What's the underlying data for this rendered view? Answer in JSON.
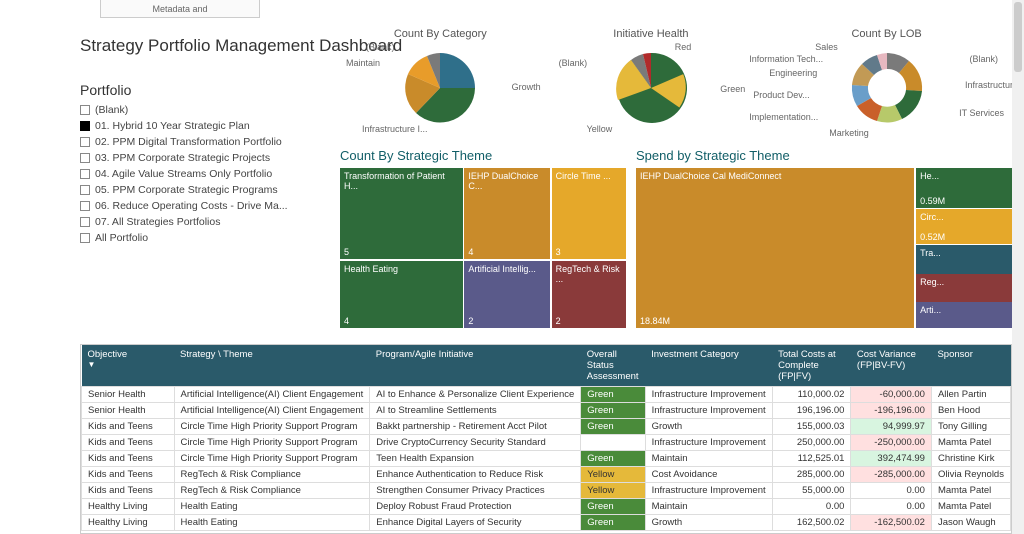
{
  "tabs": {
    "top": "Metadata and"
  },
  "title": "Strategy Portfolio Management Dashboard",
  "portfolio": {
    "heading": "Portfolio",
    "items": [
      {
        "label": "(Blank)",
        "checked": false
      },
      {
        "label": "01. Hybrid 10 Year Strategic Plan",
        "checked": true
      },
      {
        "label": "02. PPM Digital Transformation Portfolio",
        "checked": false
      },
      {
        "label": "03. PPM Corporate Strategic Projects",
        "checked": false
      },
      {
        "label": "04. Agile Value Streams Only Portfolio",
        "checked": false
      },
      {
        "label": "05. PPM Corporate Strategic Programs",
        "checked": false
      },
      {
        "label": "06. Reduce Operating Costs - Drive Ma...",
        "checked": false
      },
      {
        "label": "07. All Strategies Portfolios",
        "checked": false
      },
      {
        "label": "All Portfolio",
        "checked": false
      }
    ]
  },
  "charts": {
    "category": {
      "title": "Count By Category",
      "labels": {
        "blank": "(Blank)",
        "maintain": "Maintain",
        "growth": "Growth",
        "infra": "Infrastructure I..."
      }
    },
    "health": {
      "title": "Initiative Health",
      "labels": {
        "red": "Red",
        "blank": "(Blank)",
        "green": "Green",
        "yellow": "Yellow"
      }
    },
    "lob": {
      "title": "Count By LOB",
      "labels": {
        "sales": "Sales",
        "infotech": "Information Tech...",
        "engineering": "Engineering",
        "proddev": "Product Dev...",
        "impl": "Implementation...",
        "marketing": "Marketing",
        "blank": "(Blank)",
        "infra": "Infrastructure",
        "its": "IT Services"
      }
    }
  },
  "chart_data": [
    {
      "type": "pie",
      "title": "Count By Category",
      "series": [
        {
          "name": "Count",
          "values": [
            2,
            2,
            10,
            8
          ]
        }
      ],
      "categories": [
        "(Blank)",
        "Maintain",
        "Growth",
        "Infrastructure I..."
      ],
      "colors": [
        "#7a7a7a",
        "#e89c2a",
        "#2f6f8a",
        "#2e6b3a"
      ]
    },
    {
      "type": "pie",
      "title": "Initiative Health",
      "series": [
        {
          "name": "Count",
          "values": [
            1,
            2,
            15,
            4
          ]
        }
      ],
      "categories": [
        "Red",
        "(Blank)",
        "Green",
        "Yellow"
      ],
      "colors": [
        "#b02a2a",
        "#7a7a7a",
        "#2e6b3a",
        "#e5b93a"
      ]
    },
    {
      "type": "pie",
      "title": "Count By LOB",
      "series": [
        {
          "name": "Count",
          "values": [
            2,
            2,
            2,
            3,
            3,
            2,
            2,
            4,
            4
          ]
        }
      ],
      "categories": [
        "Sales",
        "Information Tech...",
        "Engineering",
        "Product Dev...",
        "Implementation...",
        "Marketing",
        "(Blank)",
        "Infrastructure",
        "IT Services"
      ],
      "colors": [
        "#e7b8c0",
        "#617a8a",
        "#c29a55",
        "#6a9ec9",
        "#c9602a",
        "#b7c96a",
        "#7a7a7a",
        "#c98b2a",
        "#2e6b3a"
      ]
    }
  ],
  "treemaps": {
    "count": {
      "title": "Count By Strategic Theme",
      "tiles": [
        {
          "label": "Transformation of Patient H...",
          "value": "5",
          "color": "#2e6b3a"
        },
        {
          "label": "IEHP DualChoice C...",
          "value": "4",
          "color": "#c98b2a"
        },
        {
          "label": "Circle Time ...",
          "value": "3",
          "color": "#e5a82a"
        },
        {
          "label": "Health Eating",
          "value": "4",
          "color": "#2e6b3a"
        },
        {
          "label": "Artificial Intellig...",
          "value": "2",
          "color": "#5a5a8a"
        },
        {
          "label": "RegTech & Risk ...",
          "value": "2",
          "color": "#8a3a3a"
        }
      ]
    },
    "spend": {
      "title": "Spend by Strategic Theme",
      "tiles": [
        {
          "label": "IEHP DualChoice Cal MediConnect",
          "value": "18.84M",
          "color": "#c98b2a"
        },
        {
          "label": "He...",
          "value": "0.59M",
          "color": "#2e6b3a"
        },
        {
          "label": "Circ...",
          "value": "0.52M",
          "color": "#e5a82a"
        },
        {
          "label": "Tra...",
          "value": "",
          "color": "#2a5a6a"
        },
        {
          "label": "Reg...",
          "value": "",
          "color": "#8a3a3a"
        },
        {
          "label": "Arti...",
          "value": "",
          "color": "#5a5a8a"
        }
      ]
    }
  },
  "table": {
    "headers": [
      "Objective",
      "Strategy \\ Theme",
      "Program/Agile Initiative",
      "Overall Status Assessment",
      "Investment Category",
      "Total Costs at Complete (FP|FV)",
      "Cost Variance (FP|BV-FV)",
      "Sponsor"
    ],
    "sort_indicator": "▼",
    "rows": [
      {
        "obj": "Senior Health",
        "theme": "Artificial Intelligence(AI) Client Engagement",
        "prog": "AI to Enhance & Personalize Client Experience",
        "status": "Green",
        "statusClass": "green",
        "cat": "Infrastructure Improvement",
        "cost": "110,000.02",
        "var": "-60,000.00",
        "varClass": "neg",
        "sponsor": "Allen Partin"
      },
      {
        "obj": "Senior Health",
        "theme": "Artificial Intelligence(AI) Client Engagement",
        "prog": "AI to Streamline Settlements",
        "status": "Green",
        "statusClass": "green",
        "cat": "Infrastructure Improvement",
        "cost": "196,196.00",
        "var": "-196,196.00",
        "varClass": "neg",
        "sponsor": "Ben Hood"
      },
      {
        "obj": "Kids and Teens",
        "theme": "Circle Time High Priority Support Program",
        "prog": "Bakkt partnership - Retirement Acct Pilot",
        "status": "Green",
        "statusClass": "green",
        "cat": "Growth",
        "cost": "155,000.03",
        "var": "94,999.97",
        "varClass": "pos",
        "sponsor": "Tony Gilling"
      },
      {
        "obj": "Kids and Teens",
        "theme": "Circle Time High Priority Support Program",
        "prog": "Drive CryptoCurrency Security Standard",
        "status": "",
        "statusClass": "",
        "cat": "Infrastructure Improvement",
        "cost": "250,000.00",
        "var": "-250,000.00",
        "varClass": "neg",
        "sponsor": "Mamta Patel"
      },
      {
        "obj": "Kids and Teens",
        "theme": "Circle Time High Priority Support Program",
        "prog": "Teen Health Expansion",
        "status": "Green",
        "statusClass": "green",
        "cat": "Maintain",
        "cost": "112,525.01",
        "var": "392,474.99",
        "varClass": "pos",
        "sponsor": "Christine Kirk"
      },
      {
        "obj": "Kids and Teens",
        "theme": "RegTech & Risk Compliance",
        "prog": "Enhance Authentication to Reduce Risk",
        "status": "Yellow",
        "statusClass": "yellow",
        "cat": "Cost Avoidance",
        "cost": "285,000.00",
        "var": "-285,000.00",
        "varClass": "neg",
        "sponsor": "Olivia Reynolds"
      },
      {
        "obj": "Kids and Teens",
        "theme": "RegTech & Risk Compliance",
        "prog": "Strengthen Consumer Privacy Practices",
        "status": "Yellow",
        "statusClass": "yellow",
        "cat": "Infrastructure Improvement",
        "cost": "55,000.00",
        "var": "0.00",
        "varClass": "",
        "sponsor": "Mamta Patel"
      },
      {
        "obj": "Healthy Living",
        "theme": "Health Eating",
        "prog": "Deploy Robust Fraud Protection",
        "status": "Green",
        "statusClass": "green",
        "cat": "Maintain",
        "cost": "0.00",
        "var": "0.00",
        "varClass": "",
        "sponsor": "Mamta Patel"
      },
      {
        "obj": "Healthy Living",
        "theme": "Health Eating",
        "prog": "Enhance Digital Layers of Security",
        "status": "Green",
        "statusClass": "green",
        "cat": "Growth",
        "cost": "162,500.02",
        "var": "-162,500.02",
        "varClass": "neg",
        "sponsor": "Jason Waugh"
      }
    ]
  }
}
